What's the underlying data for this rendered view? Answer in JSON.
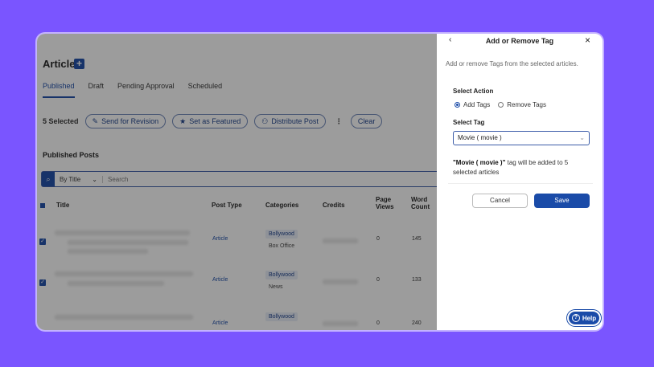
{
  "colors": {
    "background": "#7a55ff",
    "accent": "#1a4ba8"
  },
  "page": {
    "title": "Article",
    "add_icon": "plus-icon",
    "tabs": [
      {
        "label": "Published",
        "active": true
      },
      {
        "label": "Draft"
      },
      {
        "label": "Pending Approval"
      },
      {
        "label": "Scheduled"
      }
    ],
    "toolbar": {
      "selected": "5 Selected",
      "send_revision": "Send for Revision",
      "set_featured": "Set as Featured",
      "distribute": "Distribute Post",
      "clear": "Clear"
    },
    "section_label": "Published Posts",
    "search": {
      "by": "By Title",
      "placeholder": "Search"
    },
    "columns": [
      "Title",
      "Post Type",
      "Categories",
      "Credits",
      "Page Views",
      "Word Count"
    ],
    "rows": [
      {
        "post_type": "Article",
        "category": "Bollywood",
        "subcategory": "Box Office",
        "page_views": "0",
        "word_count": "145"
      },
      {
        "post_type": "Article",
        "category": "Bollywood",
        "subcategory": "News",
        "page_views": "0",
        "word_count": "133"
      },
      {
        "post_type": "Article",
        "category": "Bollywood",
        "subcategory": "",
        "page_views": "0",
        "word_count": "240"
      }
    ]
  },
  "panel": {
    "title": "Add or Remove Tag",
    "description": "Add or remove Tags from the selected articles.",
    "select_action_label": "Select Action",
    "option_add": "Add Tags",
    "option_remove": "Remove Tags",
    "selected_option": "Add Tags",
    "select_tag_label": "Select Tag",
    "tag_value": "Movie ( movie )",
    "note_tag": "\"Movie ( movie )\"",
    "note_rest": " tag will be added to 5 selected articles",
    "cancel": "Cancel",
    "save": "Save",
    "help": "Help"
  }
}
